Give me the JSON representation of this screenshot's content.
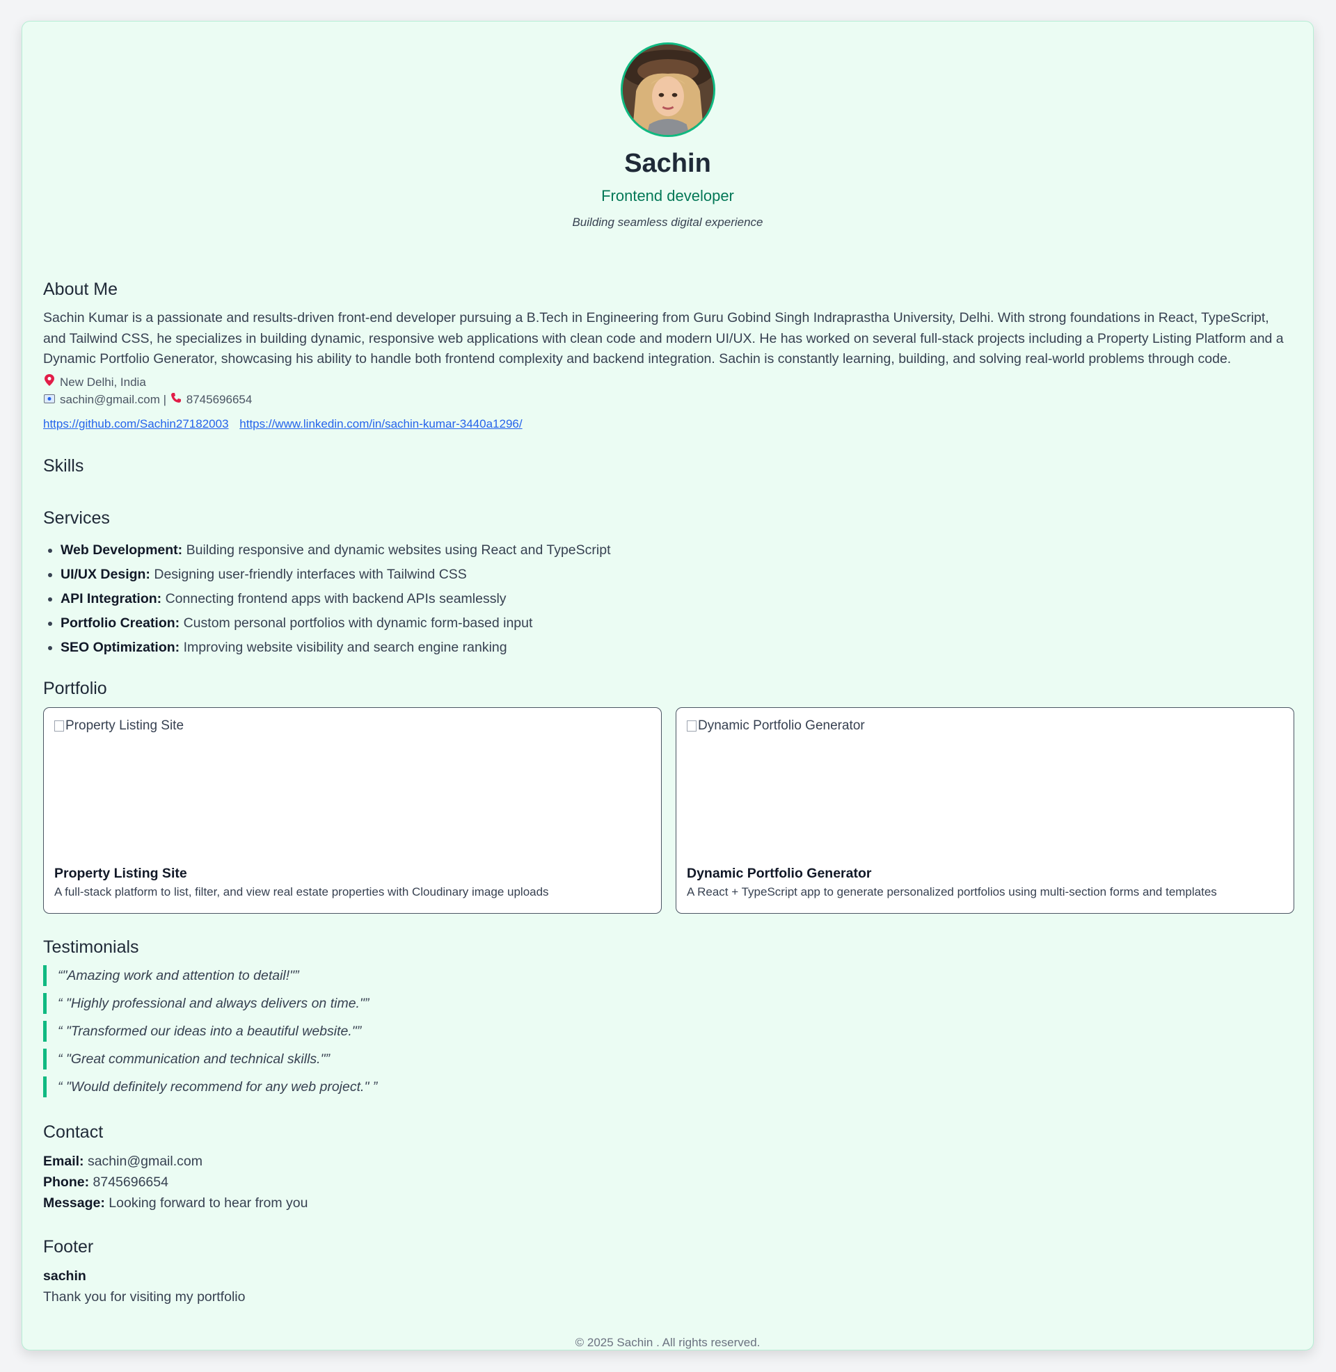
{
  "profile": {
    "name": "Sachin",
    "role": "Frontend developer",
    "tagline": "Building seamless digital experience"
  },
  "about": {
    "title": "About Me",
    "text": "Sachin Kumar is a passionate and results-driven front-end developer pursuing a B.Tech in Engineering from Guru Gobind Singh Indraprastha University, Delhi. With strong foundations in React, TypeScript, and Tailwind CSS, he specializes in building dynamic, responsive web applications with clean code and modern UI/UX. He has worked on several full-stack projects including a Property Listing Platform and a Dynamic Portfolio Generator, showcasing his ability to handle both frontend complexity and backend integration. Sachin is constantly learning, building, and solving real-world problems through code.",
    "location": "New Delhi, India",
    "email": "sachin@gmail.com",
    "separator": "|",
    "phone": "8745696654",
    "links": [
      "https://github.com/Sachin27182003",
      "https://www.linkedin.com/in/sachin-kumar-3440a1296/"
    ]
  },
  "skills": {
    "title": "Skills"
  },
  "services": {
    "title": "Services",
    "items": [
      {
        "name": "Web Development:",
        "desc": "Building responsive and dynamic websites using React and TypeScript"
      },
      {
        "name": "UI/UX Design:",
        "desc": "Designing user-friendly interfaces with Tailwind CSS"
      },
      {
        "name": "API Integration:",
        "desc": "Connecting frontend apps with backend APIs seamlessly"
      },
      {
        "name": "Portfolio Creation:",
        "desc": "Custom personal portfolios with dynamic form-based input"
      },
      {
        "name": "SEO Optimization:",
        "desc": "Improving website visibility and search engine ranking"
      }
    ]
  },
  "portfolio": {
    "title": "Portfolio",
    "projects": [
      {
        "image_alt": "Property Listing Site",
        "title": "Property Listing Site",
        "desc": "A full-stack platform to list, filter, and view real estate properties with Cloudinary image uploads"
      },
      {
        "image_alt": "Dynamic Portfolio Generator",
        "title": "Dynamic Portfolio Generator",
        "desc": "A React + TypeScript app to generate personalized portfolios using multi-section forms and templates"
      }
    ]
  },
  "testimonials": {
    "title": "Testimonials",
    "quotes": [
      "“\"Amazing work and attention to detail!\"”",
      "“ \"Highly professional and always delivers on time.\"”",
      "“ \"Transformed our ideas into a beautiful website.\"”",
      "“ \"Great communication and technical skills.\"”",
      "“ \"Would definitely recommend for any web project.\" ”"
    ]
  },
  "contact": {
    "title": "Contact",
    "email_label": "Email:",
    "email": "sachin@gmail.com",
    "phone_label": "Phone:",
    "phone": "8745696654",
    "message_label": "Message:",
    "message": "Looking forward to hear from you"
  },
  "footer": {
    "title": "Footer",
    "name": "sachin",
    "text": "Thank you for visiting my portfolio",
    "copyright": "© 2025 Sachin . All rights reserved."
  },
  "icons": {
    "location": "location-pin-icon",
    "email": "email-icon",
    "phone": "phone-icon"
  },
  "colors": {
    "accent": "#10b981",
    "role_text": "#047857",
    "link": "#2563eb",
    "card_bg": "#ebfcf3"
  }
}
